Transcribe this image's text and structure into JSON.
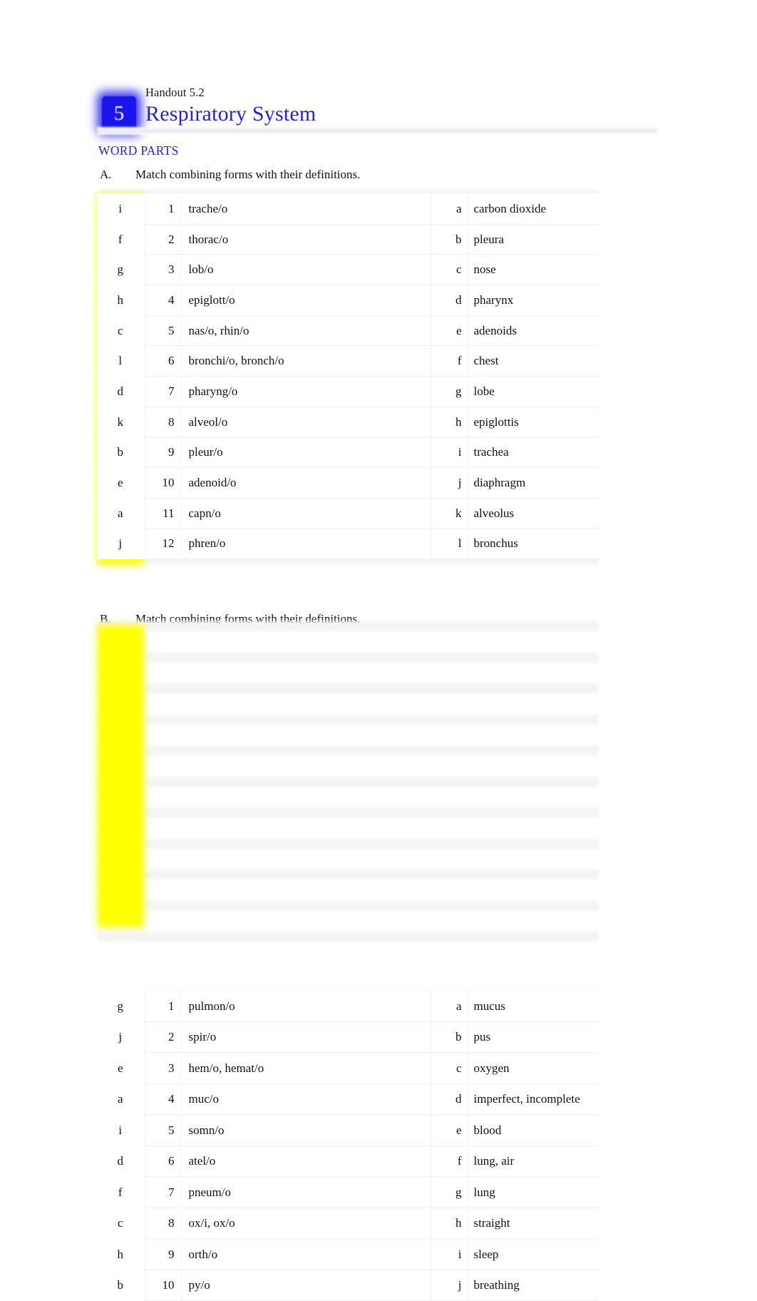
{
  "header": {
    "chapter_number": "5",
    "handout_label": "Handout 5.2",
    "title": "Respiratory System",
    "badge_color": "#1a14ee",
    "title_color": "#2222dd"
  },
  "section": {
    "heading": "WORD PARTS",
    "heading_color": "#2222dd"
  },
  "highlight_color": "#ffff00",
  "exercises": [
    {
      "letter": "A.",
      "prompt": "Match combining forms with their definitions.",
      "rows": [
        {
          "answer": "i",
          "num": "1",
          "term": "trache/o",
          "rletter": "a",
          "rdef": "carbon dioxide"
        },
        {
          "answer": "f",
          "num": "2",
          "term": "thorac/o",
          "rletter": "b",
          "rdef": "pleura"
        },
        {
          "answer": "g",
          "num": "3",
          "term": "lob/o",
          "rletter": "c",
          "rdef": "nose"
        },
        {
          "answer": "h",
          "num": "4",
          "term": "epiglott/o",
          "rletter": "d",
          "rdef": "pharynx"
        },
        {
          "answer": "c",
          "num": "5",
          "term": "nas/o, rhin/o",
          "rletter": "e",
          "rdef": "adenoids"
        },
        {
          "answer": "l",
          "num": "6",
          "term": "bronchi/o, bronch/o",
          "rletter": "f",
          "rdef": "chest"
        },
        {
          "answer": "d",
          "num": "7",
          "term": "pharyng/o",
          "rletter": "g",
          "rdef": "lobe"
        },
        {
          "answer": "k",
          "num": "8",
          "term": "alveol/o",
          "rletter": "h",
          "rdef": "epiglottis"
        },
        {
          "answer": "b",
          "num": "9",
          "term": "pleur/o",
          "rletter": "i",
          "rdef": "trachea"
        },
        {
          "answer": "e",
          "num": "10",
          "term": "adenoid/o",
          "rletter": "j",
          "rdef": "diaphragm"
        },
        {
          "answer": "a",
          "num": "11",
          "term": "capn/o",
          "rletter": "k",
          "rdef": "alveolus"
        },
        {
          "answer": "j",
          "num": "12",
          "term": "phren/o",
          "rletter": "l",
          "rdef": "bronchus"
        }
      ]
    },
    {
      "letter": "B.",
      "prompt": "Match combining forms with their definitions.",
      "rows": [
        {
          "answer": "g",
          "num": "1",
          "term": "pulmon/o",
          "rletter": "a",
          "rdef": "mucus"
        },
        {
          "answer": "j",
          "num": "2",
          "term": "spir/o",
          "rletter": "b",
          "rdef": "pus"
        },
        {
          "answer": "e",
          "num": "3",
          "term": "hem/o, hemat/o",
          "rletter": "c",
          "rdef": "oxygen"
        },
        {
          "answer": "a",
          "num": "4",
          "term": "muc/o",
          "rletter": "d",
          "rdef": "imperfect, incomplete"
        },
        {
          "answer": "i",
          "num": "5",
          "term": "somn/o",
          "rletter": "e",
          "rdef": "blood"
        },
        {
          "answer": "d",
          "num": "6",
          "term": "atel/o",
          "rletter": "f",
          "rdef": "lung, air"
        },
        {
          "answer": "f",
          "num": "7",
          "term": "pneum/o",
          "rletter": "g",
          "rdef": "lung"
        },
        {
          "answer": "c",
          "num": "8",
          "term": "ox/i, ox/o",
          "rletter": "h",
          "rdef": "straight"
        },
        {
          "answer": "h",
          "num": "9",
          "term": "orth/o",
          "rletter": "i",
          "rdef": "sleep"
        },
        {
          "answer": "b",
          "num": "10",
          "term": "py/o",
          "rletter": "j",
          "rdef": "breathing"
        }
      ]
    }
  ]
}
